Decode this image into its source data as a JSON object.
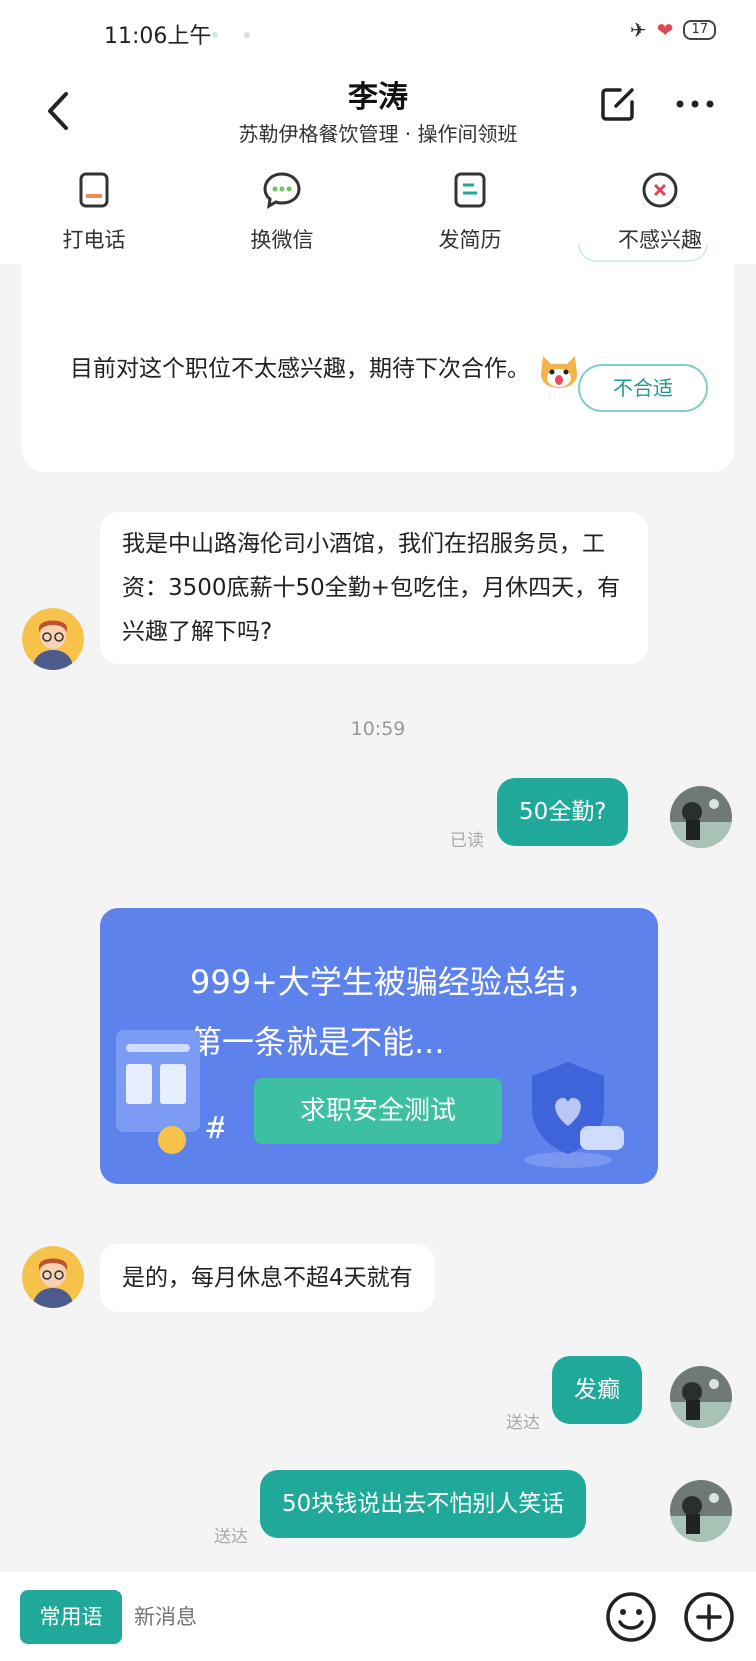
{
  "status_bar": {
    "time": "11:06上午",
    "battery": "17"
  },
  "header": {
    "name": "李涛",
    "subtitle": "苏勒伊格餐饮管理 · 操作间领班"
  },
  "actions": [
    {
      "label": "打电话",
      "icon": "phone-icon"
    },
    {
      "label": "换微信",
      "icon": "wechat-icon"
    },
    {
      "label": "发简历",
      "icon": "resume-icon"
    },
    {
      "label": "不感兴趣",
      "icon": "not-interested-icon"
    }
  ],
  "card": {
    "text": "目前对这个职位不太感兴趣，期待下次合作。",
    "button": "不合适"
  },
  "messages": {
    "m1": "我是中山路海伦司小酒馆，我们在招服务员，工资：3500底薪十50全勤+包吃住，月休四天，有兴趣了解下吗?",
    "timestamp": "10:59",
    "m2": "50全勤?",
    "m2_status": "已读",
    "m3": "是的，每月休息不超4天就有",
    "m4": "发癫",
    "m4_status": "送达",
    "m5": "50块钱说出去不怕别人笑话",
    "m5_status": "送达"
  },
  "promo": {
    "title": "999+大学生被骗经验总结，第一条就是不能...",
    "button": "求职安全测试"
  },
  "input_bar": {
    "common_phrases": "常用语",
    "placeholder": "新消息"
  },
  "colors": {
    "accent": "#20a99a",
    "promo_bg": "#5e82ec",
    "promo_button": "#3dbfa3"
  }
}
